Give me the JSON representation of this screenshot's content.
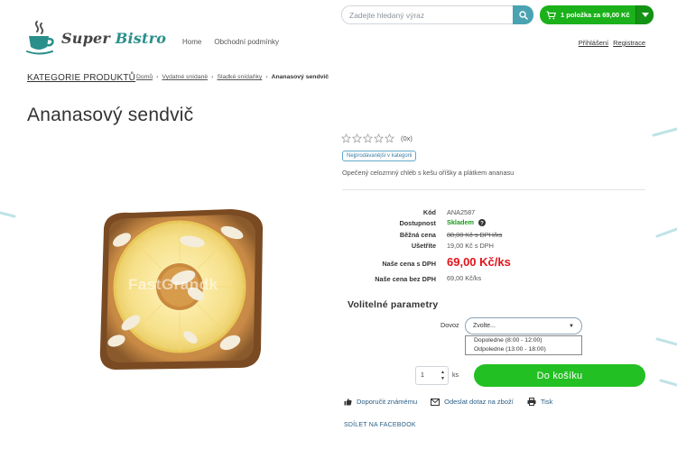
{
  "brand": {
    "name_part1": "Super",
    "name_part2": "Bistro"
  },
  "nav": [
    "Home",
    "Obchodní podmínky"
  ],
  "search": {
    "placeholder": "Zadejte hledaný výraz"
  },
  "cart": {
    "label": "1 položka za 69,00 Kč"
  },
  "account": {
    "login": "Přihlášení",
    "register": "Registrace"
  },
  "categories_link": "KATEGORIE PRODUKTŮ",
  "breadcrumb": [
    "Domů",
    "Vydatné snídaně",
    "Sladké snídaňky",
    "Ananasový sendvič"
  ],
  "product": {
    "title": "Ananasový sendvič",
    "rating_stars": 0,
    "rating_count": "(0x)",
    "badge": "Nejprodávanější v kategorii",
    "description": "Opečený celozrnný chléb s kešu oříšky a plátkem ananasu",
    "watermark": "FastGrandk",
    "info": {
      "code_label": "Kód",
      "code": "ANA2587",
      "availability_label": "Dostupnost",
      "availability": "Skladem",
      "regular_label": "Běžná cena",
      "regular": "88,00 Kč s DPH/ks",
      "save_label": "Ušetříte",
      "save": "19,00 Kč s DPH",
      "price_label": "Naše cena s DPH",
      "price": "69,00 Kč/ks",
      "price_net_label": "Naše cena bez DPH",
      "price_net": "69,00 Kč/ks"
    }
  },
  "params": {
    "title": "Volitelné parametry",
    "dovoz_label": "Dovoz",
    "selected": "Zvolte...",
    "options": [
      "Dopoledne (8:00 - 12:00)",
      "Odpoledne (13:00 - 18:00)"
    ]
  },
  "purchase": {
    "quantity": "1",
    "unit": "ks",
    "button": "Do košíku"
  },
  "actions": {
    "recommend": "Doporučit známému",
    "ask": "Odeslat dotaz na zboží",
    "print": "Tisk",
    "share": "SDÍLET NA FACEBOOK"
  },
  "colors": {
    "accent_green": "#22c022",
    "price_red": "#e3131b",
    "teal": "#2a8f8a"
  }
}
